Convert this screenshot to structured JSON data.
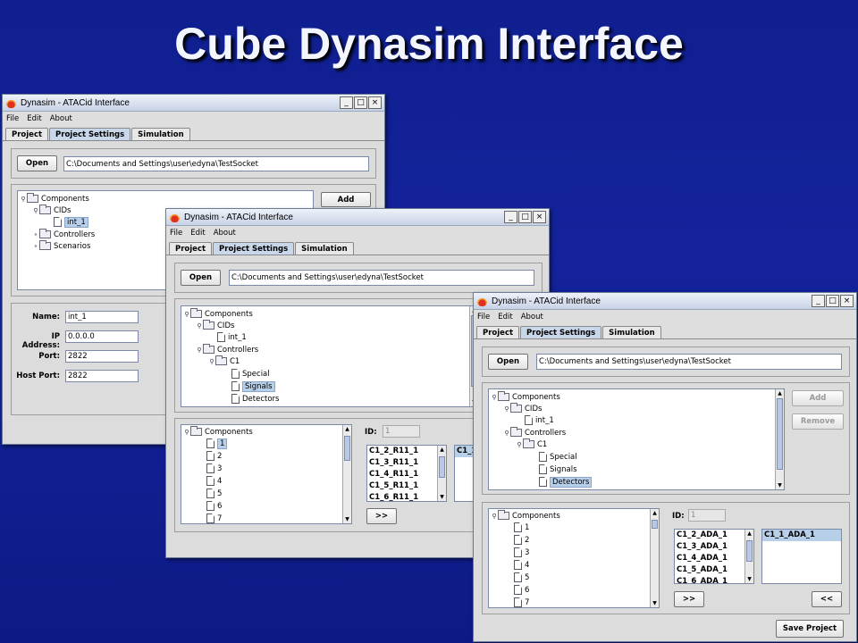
{
  "slide_title": "Cube Dynasim Interface",
  "window_title": "Dynasim - ATACid Interface",
  "menu": [
    "File",
    "Edit",
    "About"
  ],
  "tabs": [
    "Project",
    "Project Settings",
    "Simulation"
  ],
  "win_buttons": {
    "minimize": "_",
    "maximize": "□",
    "close": "×"
  },
  "open_label": "Open",
  "project_path": "C:\\Documents and Settings\\user\\edyna\\TestSocket",
  "add_label": "Add",
  "remove_label": "Remove",
  "save_label": "Save Project",
  "move_right_label": ">>",
  "move_left_label": "<<",
  "id_label": "ID:",
  "id_value": "1",
  "tree": {
    "components": "Components",
    "cids": "CIDs",
    "int1": "int_1",
    "controllers": "Controllers",
    "scenarios": "Scenarios",
    "c1": "C1",
    "special": "Special",
    "signals": "Signals",
    "detectors": "Detectors"
  },
  "component_nodes": [
    "1",
    "2",
    "3",
    "4",
    "5",
    "6",
    "7"
  ],
  "form": {
    "name_label": "Name:",
    "name_value": "int_1",
    "ip_label": "IP Address:",
    "ip_value": "0.0.0.0",
    "port_label": "Port:",
    "port_value": "2822",
    "host_port_label": "Host Port:",
    "host_port_value": "2822"
  },
  "win2_list": [
    "C1_2_R11_1",
    "C1_3_R11_1",
    "C1_4_R11_1",
    "C1_5_R11_1",
    "C1_6_R11_1"
  ],
  "win2_selected": "C1_1",
  "win3_list": [
    "C1_2_ADA_1",
    "C1_3_ADA_1",
    "C1_4_ADA_1",
    "C1_5_ADA_1",
    "C1_6_ADA_1"
  ],
  "win3_selected": "C1_1_ADA_1"
}
